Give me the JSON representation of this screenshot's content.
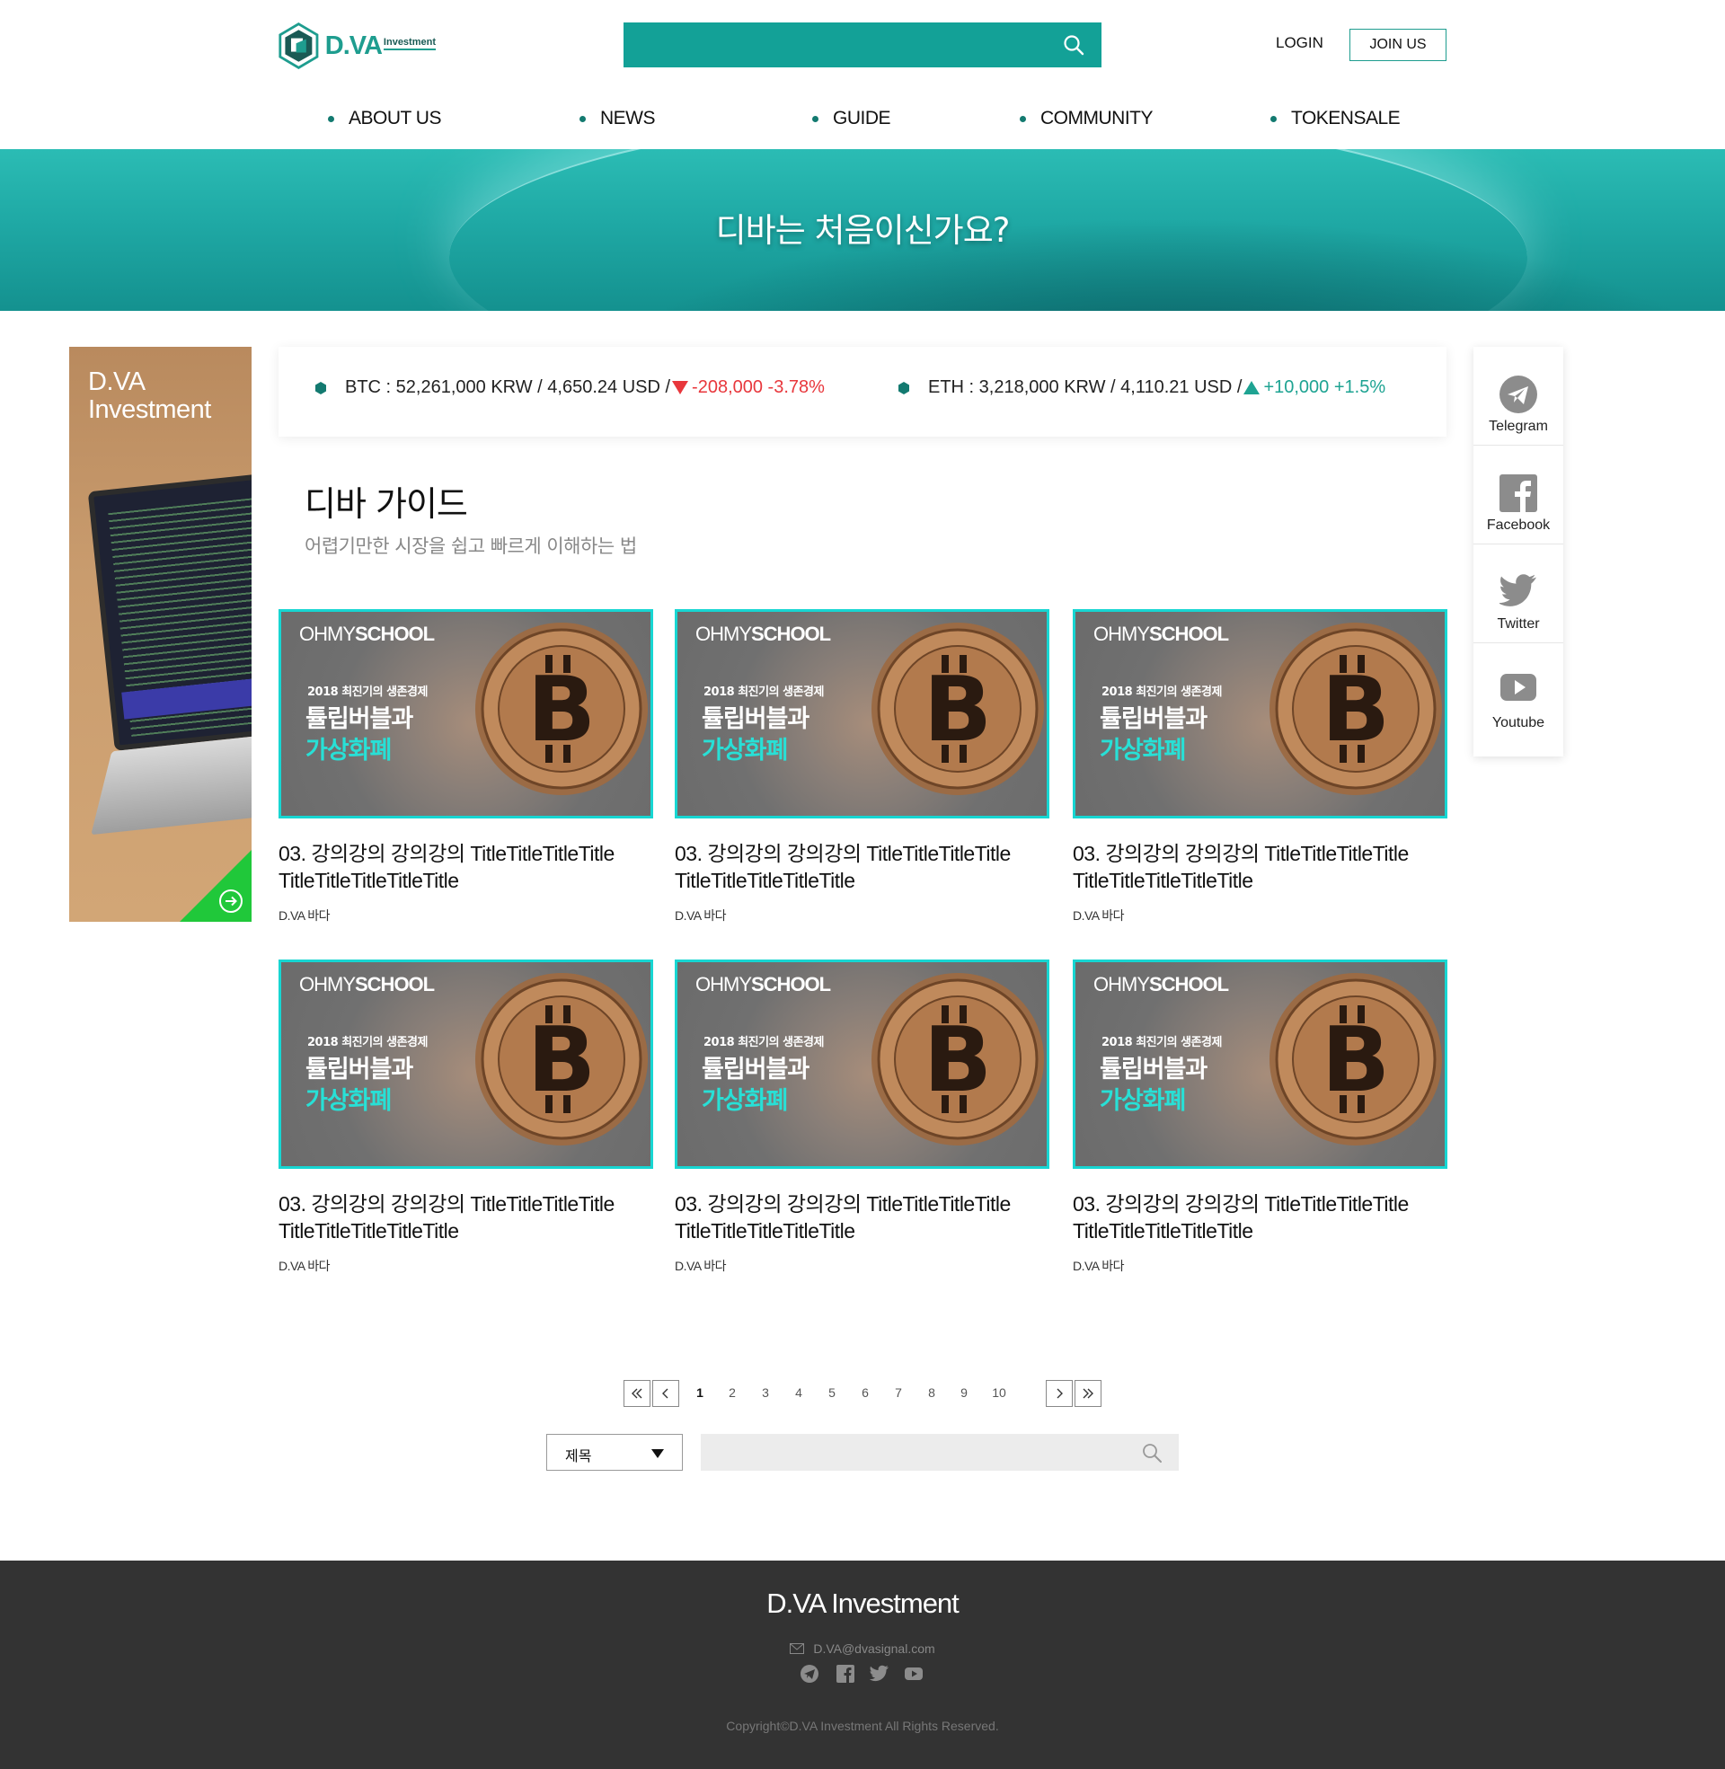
{
  "header": {
    "logo_text": "D.VA",
    "logo_sub": "Investment",
    "search_placeholder": "",
    "login_label": "LOGIN",
    "join_label": "JOIN US"
  },
  "nav": {
    "items": [
      {
        "label": "ABOUT US"
      },
      {
        "label": "NEWS"
      },
      {
        "label": "GUIDE"
      },
      {
        "label": "COMMUNITY"
      },
      {
        "label": "TOKENSALE"
      }
    ]
  },
  "banner": {
    "title": "디바는 처음이신가요?"
  },
  "left_ad": {
    "title_line1": "D.VA",
    "title_line2": "Investment",
    "arrow_icon": "arrow-right-circle-icon",
    "accent": "#20c83a"
  },
  "ticker": {
    "btc": {
      "text": "BTC : 52,261,000 KRW / 4,650.24 USD / ",
      "change": "-208,000 -3.78%",
      "direction": "down"
    },
    "eth": {
      "text": "ETH : 3,218,000 KRW / 4,110.21 USD / ",
      "change": "+10,000 +1.5%",
      "direction": "up"
    },
    "down_color": "#e8373c",
    "up_color": "#1ea392"
  },
  "section": {
    "title": "디바 가이드",
    "subtitle": "어렵기만한 시장을 쉽고 빠르게 이해하는 법"
  },
  "thumbnail": {
    "brand_light": "OHMY",
    "brand_bold": "SCHOOL",
    "line1": "2018 최진기의 생존경제",
    "line2": "튤립버블과",
    "line3": "가상화폐",
    "border_color": "#17d6d2"
  },
  "cards": [
    {
      "title": "03. 강의강의 강의강의 TitleTitleTitleTitle TitleTitleTitleTitleTitle",
      "author": "D.VA 바다"
    },
    {
      "title": "03. 강의강의 강의강의 TitleTitleTitleTitle TitleTitleTitleTitleTitle",
      "author": "D.VA 바다"
    },
    {
      "title": "03. 강의강의 강의강의 TitleTitleTitleTitle TitleTitleTitleTitleTitle",
      "author": "D.VA 바다"
    },
    {
      "title": "03. 강의강의 강의강의 TitleTitleTitleTitle TitleTitleTitleTitleTitle",
      "author": "D.VA 바다"
    },
    {
      "title": "03. 강의강의 강의강의 TitleTitleTitleTitle TitleTitleTitleTitleTitle",
      "author": "D.VA 바다"
    },
    {
      "title": "03. 강의강의 강의강의 TitleTitleTitleTitle TitleTitleTitleTitleTitle",
      "author": "D.VA 바다"
    }
  ],
  "social": {
    "items": [
      {
        "label": "Telegram",
        "icon": "telegram-icon"
      },
      {
        "label": "Facebook",
        "icon": "facebook-icon"
      },
      {
        "label": "Twitter",
        "icon": "twitter-icon"
      },
      {
        "label": "Youtube",
        "icon": "youtube-icon"
      }
    ]
  },
  "pagination": {
    "pages": [
      "1",
      "2",
      "3",
      "4",
      "5",
      "6",
      "7",
      "8",
      "9",
      "10"
    ],
    "current": "1"
  },
  "search": {
    "select_value": "제목",
    "input_value": ""
  },
  "footer": {
    "title": "D.VA Investment",
    "email": "D.VA@dvasignal.com",
    "copyright": "Copyright©D.VA Investment All Rights Reserved."
  },
  "colors": {
    "brand": "#13a197",
    "footer_bg": "#333333"
  }
}
